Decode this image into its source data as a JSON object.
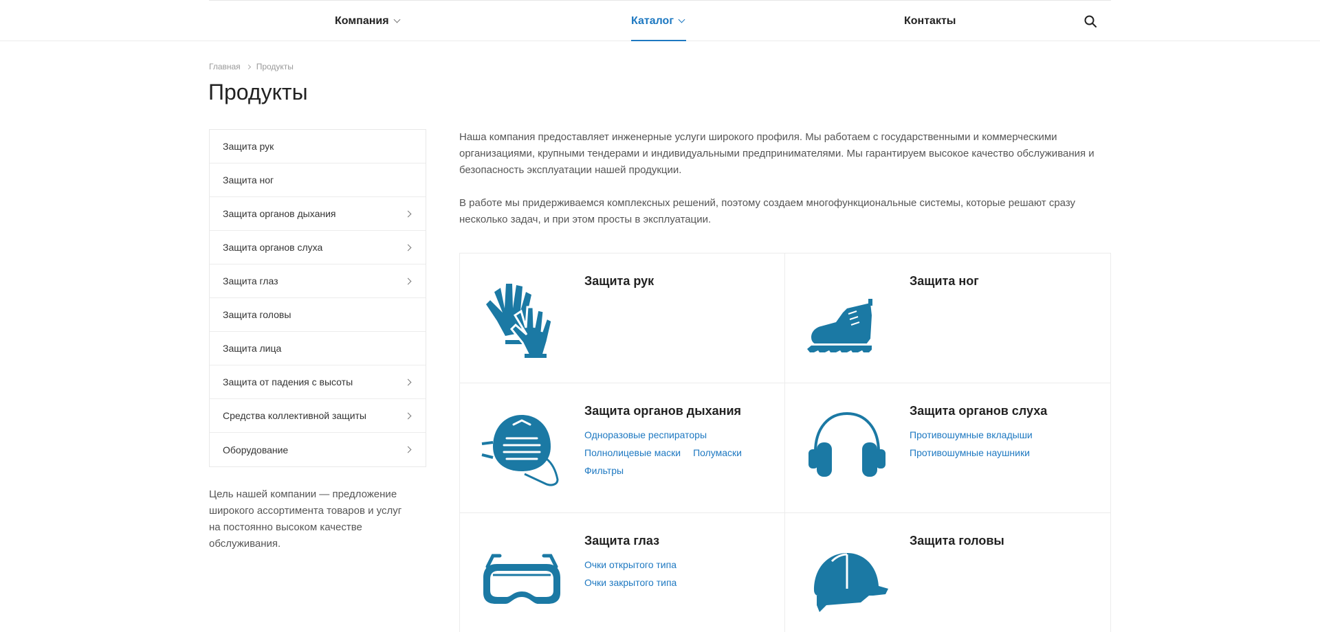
{
  "nav": {
    "items": [
      {
        "label": "Компания"
      },
      {
        "label": "Каталог"
      },
      {
        "label": "Контакты"
      }
    ]
  },
  "breadcrumb": {
    "home": "Главная",
    "current": "Продукты"
  },
  "page": {
    "title": "Продукты"
  },
  "sidebar": {
    "items": [
      {
        "label": "Защита рук"
      },
      {
        "label": "Защита ног"
      },
      {
        "label": "Защита органов дыхания"
      },
      {
        "label": "Защита органов слуха"
      },
      {
        "label": "Защита глаз"
      },
      {
        "label": "Защита головы"
      },
      {
        "label": "Защита лица"
      },
      {
        "label": "Защита от падения с высоты"
      },
      {
        "label": "Средства коллективной защиты"
      },
      {
        "label": "Оборудование"
      }
    ],
    "note": "Цель нашей компании — предложение широкого ассортимента товаров и услуг на постоянно высоком качестве обслуживания."
  },
  "intro": {
    "p1": "Наша компания предоставляет инженерные услуги широкого профиля. Мы работаем с государственными и коммерческими организациями, крупными тендерами и индивидуальными предпринимателями. Мы гарантируем высокое качество обслуживания и безопасность эксплуатации нашей продукции.",
    "p2": "В работе мы придерживаемся комплексных решений, поэтому создаем многофункциональные системы, которые решают сразу несколько задач, и при этом просты в эксплуатации."
  },
  "products": [
    {
      "name": "Защита рук",
      "icon": "gloves-icon",
      "links": []
    },
    {
      "name": "Защита ног",
      "icon": "boot-icon",
      "links": []
    },
    {
      "name": "Защита органов дыхания",
      "icon": "respirator-mask-icon",
      "links": [
        "Одноразовые респираторы",
        "Полнолицевые маски",
        "Полумаски",
        "Фильтры"
      ]
    },
    {
      "name": "Защита органов слуха",
      "icon": "earmuffs-icon",
      "links": [
        "Противошумные вкладыши",
        "Противошумные наушники"
      ]
    },
    {
      "name": "Защита глаз",
      "icon": "goggles-icon",
      "links": [
        "Очки открытого типа",
        "Очки закрытого типа"
      ]
    },
    {
      "name": "Защита головы",
      "icon": "hard-hat-icon",
      "links": []
    }
  ],
  "colors": {
    "accent": "#1d78c1",
    "icon": "#1b79a4"
  }
}
